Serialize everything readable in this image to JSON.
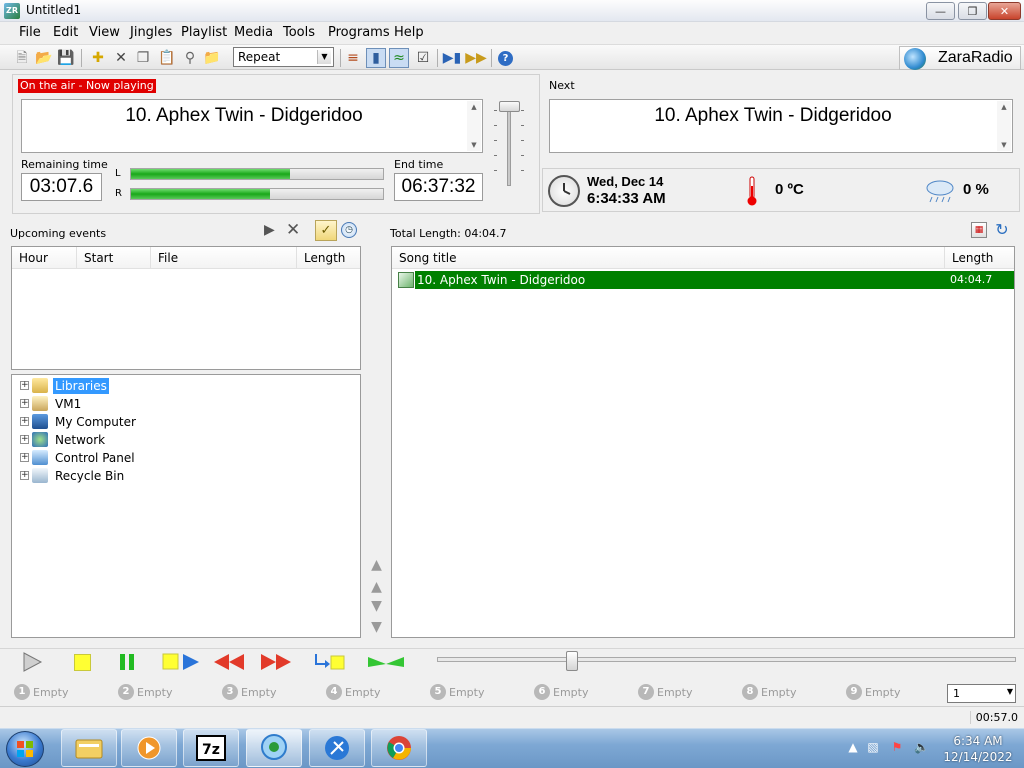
{
  "window": {
    "title": "Untitled1",
    "app_icon": "ZR"
  },
  "menu": [
    "File",
    "Edit",
    "View",
    "Jingles",
    "Playlist",
    "Media",
    "Tools",
    "Programs",
    "Help"
  ],
  "toolbar": {
    "mode_select": "Repeat",
    "brand": "ZaraRadio"
  },
  "on_air": {
    "label": "On the air - Now playing",
    "title": "10. Aphex Twin - Didgeridoo",
    "remaining_label": "Remaining time",
    "remaining": "03:07.6",
    "end_label": "End time",
    "end": "06:37:32",
    "meter_l": "L",
    "meter_r": "R",
    "level_l": 0.63,
    "level_r": 0.55
  },
  "next": {
    "label": "Next",
    "title": "10. Aphex Twin - Didgeridoo"
  },
  "info": {
    "date": "Wed, Dec 14",
    "time": "6:34:33 AM",
    "temperature": "0 ºC",
    "humidity": "0 %"
  },
  "events": {
    "label": "Upcoming events",
    "columns": [
      "Hour",
      "Start",
      "File",
      "Length"
    ]
  },
  "tree": [
    "Libraries",
    "VM1",
    "My Computer",
    "Network",
    "Control Panel",
    "Recycle Bin"
  ],
  "playlist": {
    "total": "Total Length: 04:04.7",
    "columns": [
      "Song title",
      "Length"
    ],
    "rows": [
      {
        "title": "10. Aphex Twin - Didgeridoo",
        "length": "04:04.7"
      }
    ]
  },
  "slots": [
    {
      "num": "1",
      "label": "Empty"
    },
    {
      "num": "2",
      "label": "Empty"
    },
    {
      "num": "3",
      "label": "Empty"
    },
    {
      "num": "4",
      "label": "Empty"
    },
    {
      "num": "5",
      "label": "Empty"
    },
    {
      "num": "6",
      "label": "Empty"
    },
    {
      "num": "7",
      "label": "Empty"
    },
    {
      "num": "8",
      "label": "Empty"
    },
    {
      "num": "9",
      "label": "Empty"
    }
  ],
  "slot_select": "1",
  "status": {
    "time": "00:57.0"
  },
  "taskbar": {
    "clock_time": "6:34 AM",
    "clock_date": "12/14/2022"
  }
}
